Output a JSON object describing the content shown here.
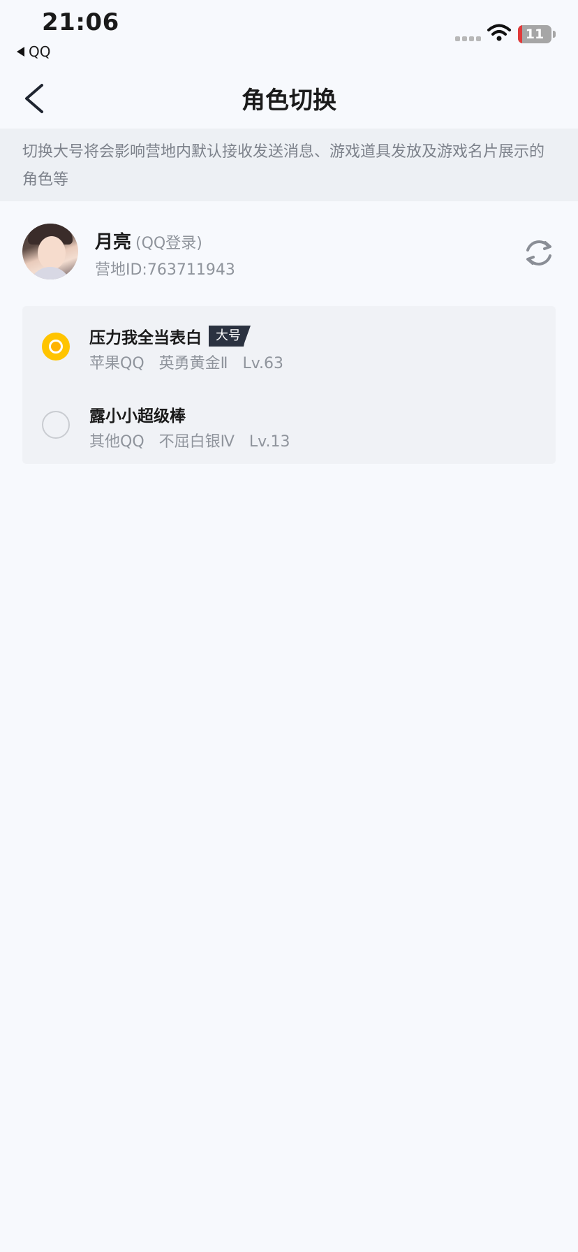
{
  "status_bar": {
    "time": "21:06",
    "back_app": "QQ",
    "battery": "11",
    "icons": [
      "signal-dots-icon",
      "wifi-icon",
      "battery-icon"
    ]
  },
  "nav": {
    "title": "角色切换",
    "back_icon": "chevron-left-icon"
  },
  "notice": "切换大号将会影响营地内默认接收发送消息、游戏道具发放及游戏名片展示的角色等",
  "user": {
    "name": "月亮",
    "login_type": "(QQ登录)",
    "camp_id": "营地ID:763711943",
    "refresh_icon": "refresh-icon"
  },
  "roles": [
    {
      "name": "压力我全当表白",
      "badge": "大号",
      "platform": "苹果QQ",
      "rank": "英勇黄金Ⅱ",
      "level": "Lv.63",
      "selected": true
    },
    {
      "name": "露小小超级棒",
      "badge": "",
      "platform": "其他QQ",
      "rank": "不屈白银Ⅳ",
      "level": "Lv.13",
      "selected": false
    }
  ],
  "colors": {
    "background": "#f7f9fd",
    "notice_bg": "#edf0f4",
    "accent_radio": "#ffc400",
    "badge_bg": "#2b3240",
    "muted_text": "#8f949c"
  }
}
